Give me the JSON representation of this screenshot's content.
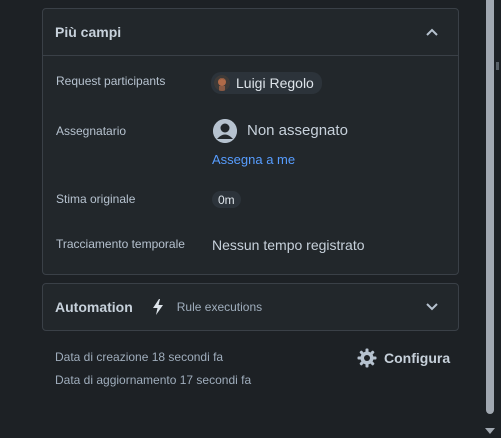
{
  "panel": {
    "title": "Più campi",
    "fields": {
      "request_participants": {
        "label": "Request participants",
        "value": "Luigi Regolo"
      },
      "assignee": {
        "label": "Assegnatario",
        "value": "Non assegnato",
        "action": "Assegna a me"
      },
      "original_estimate": {
        "label": "Stima originale",
        "value": "0m"
      },
      "time_tracking": {
        "label": "Tracciamento temporale",
        "value": "Nessun tempo registrato"
      }
    }
  },
  "automation": {
    "title": "Automation",
    "subtitle": "Rule executions"
  },
  "footer": {
    "created": "Data di creazione 18 secondi fa",
    "updated": "Data di aggiornamento 17 secondi fa",
    "configure": "Configura"
  },
  "icons": {
    "collapse": "chevron-up-icon",
    "expand": "chevron-down-icon",
    "automation": "lightning-icon",
    "configure": "gear-icon",
    "unassigned": "user-avatar-icon"
  },
  "colors": {
    "background": "#1d2125",
    "panel": "#22272b",
    "link": "#579dff",
    "border": "#3a4047"
  }
}
